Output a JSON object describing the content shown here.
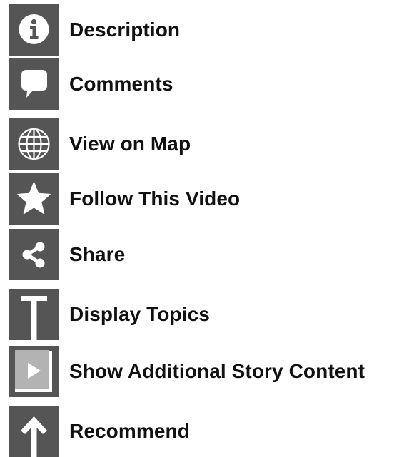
{
  "menu": {
    "items": [
      {
        "label": "Description",
        "icon": "info-icon"
      },
      {
        "label": "Comments",
        "icon": "speech-bubble-icon"
      },
      {
        "label": "View on Map",
        "icon": "globe-icon"
      },
      {
        "label": "Follow This Video",
        "icon": "star-icon"
      },
      {
        "label": "Share",
        "icon": "share-icon"
      },
      {
        "label": "Display Topics",
        "icon": "letter-t-icon"
      },
      {
        "label": "Show Additional Story Content",
        "icon": "play-box-icon"
      },
      {
        "label": "Recommend",
        "icon": "arrow-up-icon"
      }
    ]
  },
  "colors": {
    "icon_background": "#555555",
    "icon_foreground": "#ffffff",
    "label_text": "#111111"
  }
}
